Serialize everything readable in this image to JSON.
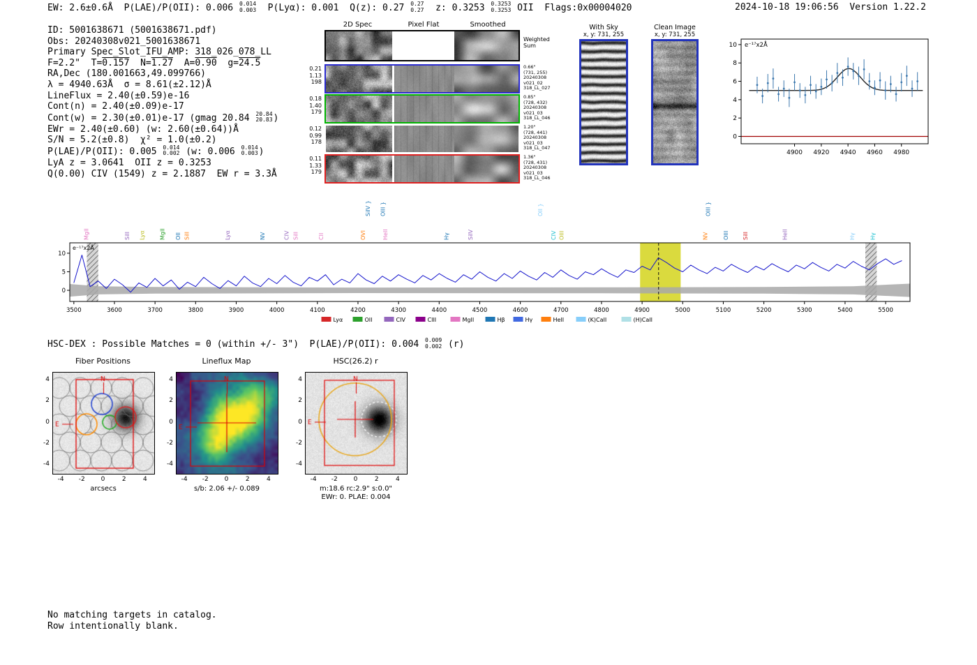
{
  "header": {
    "segments": [
      {
        "t": "EW: 2.6±0.6Å  P(LAE)/P(OII): 0.006 "
      },
      {
        "sup": "0.014",
        "sub": "0.003"
      },
      {
        "t": "  P(Lyα): 0.001  Q(z): 0.27 "
      },
      {
        "sup": "0.27",
        "sub": "0.27"
      },
      {
        "t": "  z: 0.3253 "
      },
      {
        "sup": "0.3253",
        "sub": "0.3253"
      },
      {
        "t": " OII  Flags:0x00004020"
      }
    ],
    "right": "2024-10-18 19:06:56  Version 1.22.2"
  },
  "info_lines": [
    [
      {
        "t": "ID: 5001638671 (5001638671.pdf)"
      }
    ],
    [
      {
        "t": "Obs: 20240308v021_5001638671"
      }
    ],
    [
      {
        "t": "Primary Spec_Slot_IFU_AMP: 318_026_078_LL"
      }
    ],
    [
      {
        "t": "F=2.2\"  T="
      },
      {
        "t": "0.157",
        "bar": true
      },
      {
        "t": "  N="
      },
      {
        "t": "1.27",
        "bar": true
      },
      {
        "t": "  A="
      },
      {
        "t": "0.90",
        "bar": true
      },
      {
        "t": "  g="
      },
      {
        "t": "24.5",
        "bar": true
      }
    ],
    [
      {
        "t": "RA,Dec (180.001663,49.099766)"
      }
    ],
    [
      {
        "t": "λ = 4940.63Å  σ = 8.61(±2.12)Å"
      }
    ],
    [
      {
        "t": "LineFlux = 2.40(±0.59)e-16"
      }
    ],
    [
      {
        "t": "Cont(n) = 2.40(±0.09)e-17"
      }
    ],
    [
      {
        "t": "Cont(w) = 2.30(±0.01)e-17 (gmag 20.84 "
      },
      {
        "sup": "20.84",
        "sub": "20.83"
      },
      {
        "t": ")"
      }
    ],
    [
      {
        "t": "EWr = 2.40(±0.60) (w: 2.60(±0.64))Å"
      }
    ],
    [
      {
        "t": "S/N = 5.2(±0.8)  χ² = 1.0(±0.2)"
      }
    ],
    [
      {
        "t": "P(LAE)/P(OII): 0.005 "
      },
      {
        "sup": "0.014",
        "sub": "0.002"
      },
      {
        "t": " (w: 0.006 "
      },
      {
        "sup": "0.014",
        "sub": "0.003"
      },
      {
        "t": ")"
      }
    ],
    [
      {
        "t": "LyA z = 3.0641  OII z = 0.3253"
      }
    ],
    [
      {
        "t": "Q(0.00) CIV (1549) z = 2.1887  EW r = 3.3Å"
      }
    ]
  ],
  "cutouts_2d": {
    "col_titles": [
      "2D Spec",
      "Pixel Flat",
      "Smoothed"
    ],
    "sum_label": [
      "Weighted",
      "Sum"
    ],
    "rows": [
      {
        "left": [
          "0.21",
          "1.13",
          "198"
        ],
        "right": [
          "0.66\"",
          "(731, 255)",
          "20240308",
          "v021_02",
          "318_LL_027"
        ],
        "border": "#2a2ad0"
      },
      {
        "left": [
          "0.18",
          "1.40",
          "179"
        ],
        "right": [
          "0.85\"",
          "(728, 432)",
          "20240308",
          "v021_03",
          "318_LL_046"
        ],
        "border": "#00b400"
      },
      {
        "left": [
          "0.12",
          "0.99",
          "178"
        ],
        "right": [
          "1.20\"",
          "(728, 441)",
          "20240308",
          "v021_03",
          "318_LL_047"
        ],
        "border": "none"
      },
      {
        "left": [
          "0.11",
          "1.33",
          "179"
        ],
        "right": [
          "1.36\"",
          "(728, 431)",
          "20240308",
          "v021_03",
          "318_LL_046"
        ],
        "border": "#e02020"
      }
    ]
  },
  "sky_panels": {
    "with_sky": {
      "title": "With Sky",
      "xy": "x, y: 731, 255"
    },
    "clean": {
      "title": "Clean Image",
      "xy": "x, y: 731, 255"
    },
    "border_color": "#2233bb"
  },
  "hsc_dex": {
    "segments": [
      {
        "t": "HSC-DEX : Possible Matches = 0 (within +/- 3\")  P(LAE)/P(OII): 0.004 "
      },
      {
        "sup": "0.009",
        "sub": "0.002"
      },
      {
        "t": " (r)"
      }
    ]
  },
  "footer_lines": [
    "No matching targets in catalog.",
    "Row intentionally blank."
  ],
  "cutout_row": {
    "panels": [
      {
        "title": "Fiber Positions",
        "captions": [
          "arcsecs"
        ],
        "ticks": [
          -4,
          -2,
          0,
          2,
          4
        ],
        "compass": {
          "n": "N",
          "e": "E",
          "color": "#dd0000"
        },
        "fiber_colors": [
          "#2040d0",
          "#ff8c00",
          "#22aa22",
          "#d62728"
        ]
      },
      {
        "title": "Lineflux Map",
        "captions": [
          "s/b: 2.06 +/- 0.089"
        ],
        "ticks": [
          -4,
          -2,
          0,
          2,
          4
        ],
        "compass": {
          "n": "N",
          "e": "E",
          "color": "#dd0000"
        }
      },
      {
        "title": "HSC(26.2) r",
        "captions": [
          "m:18.6 rc:2.9\"  s:0.0\"",
          "EWr: 0. PLAE: 0.004"
        ],
        "ticks": [
          -4,
          -2,
          0,
          2,
          4
        ],
        "compass": {
          "n": "N",
          "e": "E",
          "color": "#dd0000"
        },
        "aperture_color": "#e8a820"
      }
    ]
  },
  "chart_data": [
    {
      "id": "line_fit_zoom",
      "type": "scatter",
      "ylabel_inner": "e⁻¹⁷x2Å",
      "x": [
        4872,
        4876,
        4880,
        4884,
        4888,
        4892,
        4896,
        4900,
        4904,
        4908,
        4912,
        4916,
        4920,
        4924,
        4928,
        4932,
        4936,
        4940,
        4944,
        4948,
        4952,
        4956,
        4960,
        4964,
        4968,
        4972,
        4976,
        4980,
        4984,
        4988,
        4992
      ],
      "y": [
        5.6,
        4.4,
        5.8,
        6.3,
        4.6,
        5.2,
        4.2,
        5.9,
        5.0,
        4.5,
        5.6,
        4.9,
        5.4,
        6.2,
        5.8,
        6.9,
        6.4,
        7.6,
        7.1,
        6.6,
        7.3,
        6.0,
        5.3,
        6.1,
        5.0,
        5.7,
        4.6,
        5.9,
        6.6,
        5.2,
        6.0
      ],
      "yerr": [
        0.9,
        0.8,
        1.0,
        1.1,
        0.8,
        0.9,
        1.0,
        0.9,
        0.8,
        0.9,
        1.0,
        0.8,
        0.9,
        1.0,
        0.9,
        1.1,
        0.9,
        1.0,
        0.9,
        1.0,
        1.1,
        0.9,
        0.8,
        0.9,
        1.0,
        0.9,
        0.8,
        1.0,
        1.1,
        0.9,
        1.0
      ],
      "fit": {
        "type": "gaussian",
        "continuum": 5.0,
        "amplitude": 2.4,
        "center": 4940.63,
        "sigma": 8.61
      },
      "xlim": [
        4860,
        5000
      ],
      "ylim": [
        -0.8,
        10.6
      ],
      "xticks": [
        4900,
        4920,
        4940,
        4960,
        4980
      ],
      "yticks": [
        0,
        2,
        4,
        6,
        8,
        10
      ],
      "point_color": "#3a76ad",
      "fit_color": "#222222",
      "zero_line_color": "#a00000"
    },
    {
      "id": "full_spectrum",
      "type": "line",
      "ylabel_inner": "e⁻¹⁷x2Å",
      "x_start": 3500,
      "x_step": 20,
      "y": [
        2.0,
        9.5,
        1.0,
        2.5,
        0.5,
        3.0,
        1.5,
        -0.5,
        2.0,
        0.8,
        3.2,
        1.2,
        2.8,
        0.3,
        2.2,
        1.0,
        3.5,
        1.8,
        0.5,
        2.6,
        1.2,
        3.8,
        2.0,
        1.0,
        3.2,
        1.8,
        4.0,
        2.2,
        1.2,
        3.5,
        2.5,
        4.2,
        1.5,
        3.0,
        2.0,
        4.5,
        2.8,
        1.8,
        3.8,
        2.5,
        4.2,
        3.0,
        2.0,
        4.0,
        2.8,
        4.5,
        3.2,
        2.2,
        4.2,
        3.0,
        5.0,
        3.5,
        2.5,
        4.5,
        3.2,
        5.2,
        3.8,
        2.8,
        4.8,
        3.5,
        5.5,
        4.0,
        3.0,
        5.0,
        4.2,
        5.8,
        4.5,
        3.5,
        5.5,
        4.8,
        6.5,
        5.5,
        8.8,
        7.5,
        6.0,
        5.0,
        6.8,
        5.5,
        4.5,
        6.2,
        5.2,
        7.0,
        5.8,
        4.8,
        6.5,
        5.5,
        7.2,
        6.0,
        5.0,
        6.8,
        5.8,
        7.5,
        6.2,
        5.2,
        7.0,
        6.0,
        7.8,
        6.5,
        5.5,
        7.2,
        8.5,
        7.0,
        8.0
      ],
      "xlim": [
        3490,
        5560
      ],
      "ylim": [
        -3,
        12.8
      ],
      "xticks": [
        3500,
        3600,
        3700,
        3800,
        3900,
        4000,
        4100,
        4200,
        4300,
        4400,
        4500,
        4600,
        4700,
        4800,
        4900,
        5000,
        5100,
        5200,
        5300,
        5400,
        5500
      ],
      "yticks": [
        0,
        5,
        10
      ],
      "line_color": "#1414cc",
      "highlight_band": {
        "x0": 4895,
        "x1": 4995,
        "color": "#d3d31c"
      },
      "center_line": 4940.63,
      "hatch_bands": [
        {
          "x0": 3532,
          "x1": 3560
        },
        {
          "x0": 5450,
          "x1": 5478
        }
      ],
      "error_band": {
        "color": "#a8a8a8",
        "points": [
          [
            3490,
            1.7
          ],
          [
            3560,
            1.1
          ],
          [
            3700,
            0.9
          ],
          [
            4200,
            0.75
          ],
          [
            4800,
            0.8
          ],
          [
            5200,
            0.9
          ],
          [
            5420,
            1.1
          ],
          [
            5560,
            1.8
          ]
        ]
      },
      "line_labels": [
        {
          "label": "MgII",
          "wave": 3531,
          "color": "#e377c2",
          "tier": 1
        },
        {
          "label": "SiII",
          "wave": 3632,
          "color": "#9467bd",
          "tier": 1
        },
        {
          "label": "Lyα",
          "wave": 3669,
          "color": "#bcbd22",
          "tier": 1
        },
        {
          "label": "MgII",
          "wave": 3719,
          "color": "#2ca02c",
          "tier": 1
        },
        {
          "label": "OII",
          "wave": 3757,
          "color": "#1f77b4",
          "tier": 1
        },
        {
          "label": "SiII",
          "wave": 3779,
          "color": "#ff7f0e",
          "tier": 1
        },
        {
          "label": "Lyα",
          "wave": 3879,
          "color": "#9467bd",
          "tier": 1
        },
        {
          "label": "NV",
          "wave": 3965,
          "color": "#1f77b4",
          "tier": 1
        },
        {
          "label": "CIV",
          "wave": 4025,
          "color": "#9467bd",
          "tier": 1
        },
        {
          "label": "SiII",
          "wave": 4047,
          "color": "#e377c2",
          "tier": 1
        },
        {
          "label": "CII",
          "wave": 4110,
          "color": "#e377c2",
          "tier": 1
        },
        {
          "label": "OVI",
          "wave": 4213,
          "color": "#ff7f0e",
          "tier": 1
        },
        {
          "label": "SiIV }",
          "wave": 4225,
          "color": "#1f77b4",
          "tier": 2
        },
        {
          "label": "OIII }",
          "wave": 4262,
          "color": "#1f77b4",
          "tier": 2
        },
        {
          "label": "HeII",
          "wave": 4268,
          "color": "#e377c2",
          "tier": 1
        },
        {
          "label": "Hγ",
          "wave": 4418,
          "color": "#1f77b4",
          "tier": 1
        },
        {
          "label": "SiIV",
          "wave": 4478,
          "color": "#9467bd",
          "tier": 1
        },
        {
          "label": "OII }",
          "wave": 4650,
          "color": "#87cefa",
          "tier": 2
        },
        {
          "label": "CIV",
          "wave": 4682,
          "color": "#17becf",
          "tier": 1
        },
        {
          "label": "OIII",
          "wave": 4702,
          "color": "#bcbd22",
          "tier": 1
        },
        {
          "label": "NV",
          "wave": 5056,
          "color": "#ff7f0e",
          "tier": 1
        },
        {
          "label": "OIII }",
          "wave": 5063,
          "color": "#1f77b4",
          "tier": 2
        },
        {
          "label": "OIII",
          "wave": 5107,
          "color": "#1f77b4",
          "tier": 1
        },
        {
          "label": "SiII",
          "wave": 5155,
          "color": "#d62728",
          "tier": 1
        },
        {
          "label": "HeII",
          "wave": 5252,
          "color": "#9467bd",
          "tier": 1
        },
        {
          "label": "Hγ",
          "wave": 5418,
          "color": "#87cefa",
          "tier": 1
        },
        {
          "label": "Hγ",
          "wave": 5469,
          "color": "#17becf",
          "tier": 1
        }
      ],
      "legend": [
        {
          "label": "Lyα",
          "color": "#d62728"
        },
        {
          "label": "OII",
          "color": "#2ca02c"
        },
        {
          "label": "CIV",
          "color": "#9467bd"
        },
        {
          "label": "CIII",
          "color": "#8b008b"
        },
        {
          "label": "MgII",
          "color": "#e377c2"
        },
        {
          "label": "Hβ",
          "color": "#1f77b4"
        },
        {
          "label": "Hγ",
          "color": "#4169e1"
        },
        {
          "label": "HeII",
          "color": "#ff7f0e"
        },
        {
          "label": "(K)CaII",
          "color": "#87cefa"
        },
        {
          "label": "(H)CaII",
          "color": "#b0e0e6"
        }
      ]
    }
  ]
}
